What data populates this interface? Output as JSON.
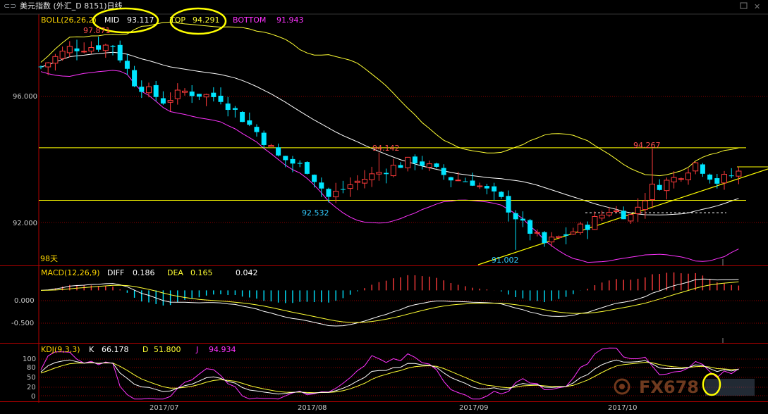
{
  "window": {
    "title": "美元指数 (外汇_D 8151)日线",
    "icon": "link-icon",
    "controls": [
      "restore-icon",
      "close-icon"
    ]
  },
  "colors": {
    "up": "#ff3b3b",
    "down": "#00e5ff",
    "mid": "#ffffff",
    "top": "#ffff33",
    "bottom": "#ff33ff",
    "grid": "#8b0000",
    "frame": "#b00000",
    "annotation": "#ffff00"
  },
  "boll": {
    "name": "BOLL(26,26,2)",
    "mid_label": "MID",
    "mid_value": "93.117",
    "top_label": "TOP",
    "top_value": "94.291",
    "bottom_label": "BOTTOM",
    "bottom_value": "91.943"
  },
  "price_axis": {
    "ticks": [
      "96.000",
      "92.000"
    ]
  },
  "price_labels": {
    "high_left": "97.871",
    "mid_high": "94.142",
    "right_high": "94.267",
    "low_mid": "92.532",
    "low_sep": "91.002",
    "period": "98天"
  },
  "macd": {
    "name": "MACD(12,26,9)",
    "diff_label": "DIFF",
    "diff_value": "0.186",
    "dea_label": "DEA",
    "dea_value": "0.165",
    "macd_value": "0.042",
    "ticks": [
      "0.000",
      "-0.500"
    ]
  },
  "kdj": {
    "name": "KDJ(9,3,3)",
    "k_label": "K",
    "k_value": "66.178",
    "d_label": "D",
    "d_value": "51.800",
    "j_label": "J",
    "j_value": "94.934",
    "ticks": [
      "100",
      "80",
      "50",
      "20",
      "0"
    ]
  },
  "x_axis": {
    "months": [
      "2017/07",
      "2017/08",
      "2017/09",
      "2017/10"
    ]
  },
  "watermark": {
    "logo": "fx678-logo"
  },
  "chart_data": {
    "type": "candlestick",
    "series": "美元指数 日线",
    "price_close_sample": [
      {
        "label": "97.871",
        "value": 97.871
      },
      {
        "label": "94.142",
        "value": 94.142
      },
      {
        "label": "92.532",
        "value": 92.532
      },
      {
        "label": "91.002",
        "value": 91.002
      },
      {
        "label": "94.267",
        "value": 94.267
      }
    ],
    "indicators": {
      "BOLL": {
        "MID": 93.117,
        "TOP": 94.291,
        "BOTTOM": 91.943
      },
      "MACD": {
        "DIFF": 0.186,
        "DEA": 0.165,
        "MACD": 0.042
      },
      "KDJ": {
        "K": 66.178,
        "D": 51.8,
        "J": 94.934
      }
    },
    "price_ylim": [
      90.5,
      98.6
    ],
    "macd_ylim": [
      -1.3,
      0.6
    ],
    "kdj_ylim": [
      -10,
      115
    ],
    "horizontal_levels": [
      94.291,
      92.6,
      92.2
    ],
    "grid": true
  }
}
